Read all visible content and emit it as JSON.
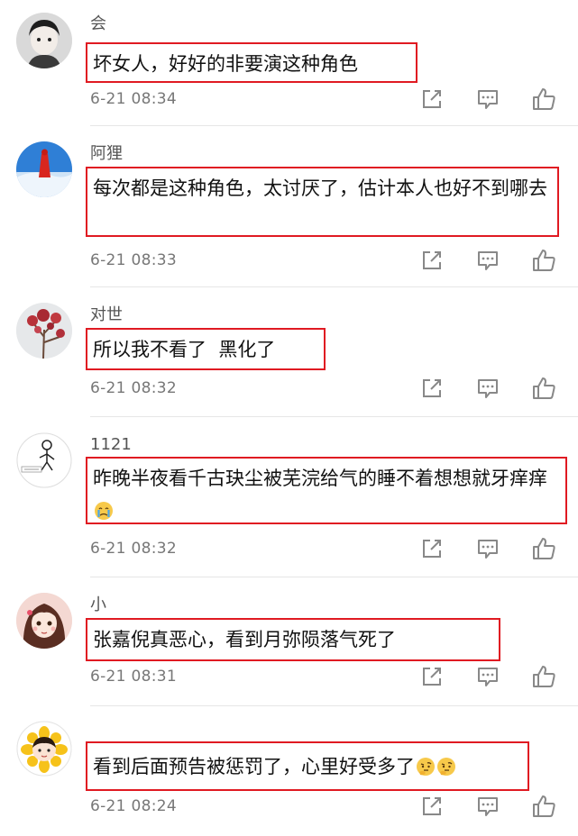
{
  "comments": [
    {
      "username": "会",
      "text": "坏女人，好好的非要演这种角色",
      "timestamp": "6-21 08:34",
      "avatar": "avatar-boy-portrait"
    },
    {
      "username": "阿狸",
      "text": "每次都是这种角色，太讨厌了，估计本人也好不到哪去",
      "timestamp": "6-21 08:33",
      "avatar": "avatar-red-figure-blue-sky"
    },
    {
      "username": "对世",
      "text": "所以我不看了  黑化了",
      "timestamp": "6-21 08:32",
      "avatar": "avatar-red-blossom-tree"
    },
    {
      "username": "1121",
      "text": "昨晚半夜看千古玦尘被芜浣给气的睡不着想想就牙痒痒",
      "timestamp": "6-21 08:32",
      "avatar": "avatar-stick-figure-sketch",
      "emoji": "crying-face-emoji"
    },
    {
      "username": "小",
      "text": "张嘉倪真恶心，看到月弥陨落气死了",
      "timestamp": "6-21 08:31",
      "avatar": "avatar-anime-girl"
    },
    {
      "username": "",
      "text": "看到后面预告被惩罚了，心里好受多了",
      "timestamp": "6-21 08:24",
      "avatar": "avatar-sunflower-girl",
      "emoji": "thinking-face-emoji"
    }
  ],
  "actions": {
    "share_icon": "share-icon",
    "reply_icon": "comment-icon",
    "like_icon": "thumbs-up-icon"
  },
  "colors": {
    "highlight_border": "#e01a22",
    "username": "#555555",
    "timestamp": "#777777",
    "icon": "#888888"
  }
}
